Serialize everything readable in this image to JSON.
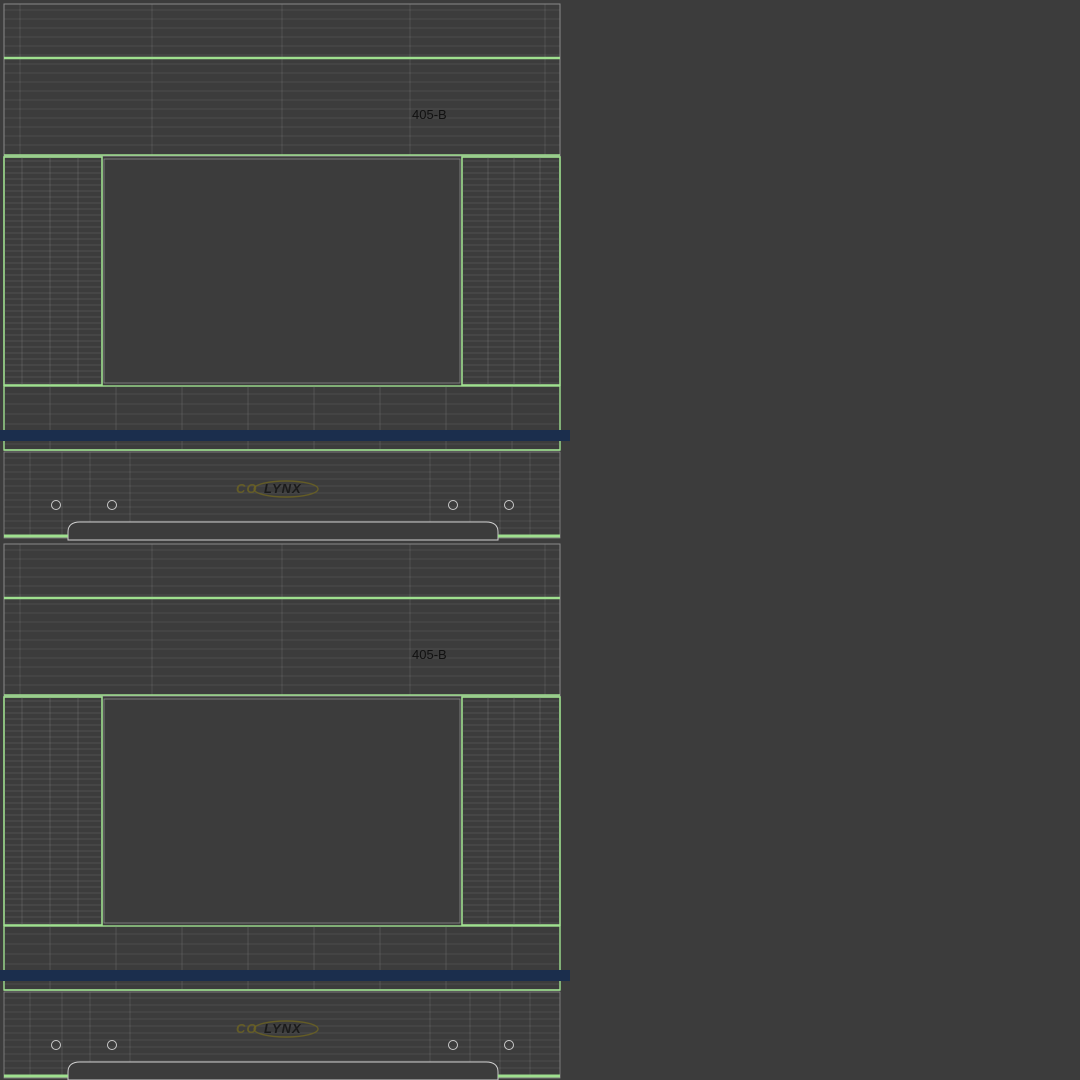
{
  "texture": {
    "background_color": "#3c3c3c",
    "wire_color": "#8a8a8a",
    "edge_color": "#9fe08f",
    "stripe_color": "#1b2e4d",
    "logo_color": "#6e6420"
  },
  "sheets": [
    {
      "label": "405-B",
      "logo": {
        "text": "LYNX",
        "prefix": "CO"
      }
    },
    {
      "label": "405-B",
      "logo": {
        "text": "LYNX",
        "prefix": "CO"
      }
    }
  ]
}
